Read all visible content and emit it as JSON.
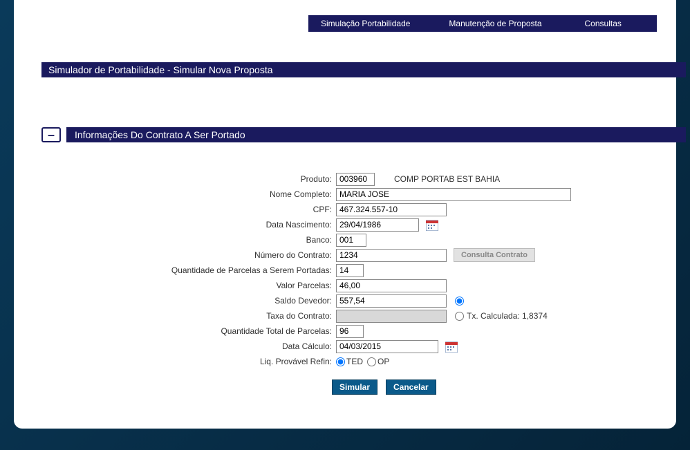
{
  "menu": {
    "simulacao": "Simulação Portabilidade",
    "manutencao": "Manutenção de Proposta",
    "consultas": "Consultas"
  },
  "page_title": "Simulador de Portabilidade - Simular Nova Proposta",
  "section": {
    "collapse_symbol": "–",
    "title": "Informações Do Contrato A Ser Portado"
  },
  "labels": {
    "produto": "Produto:",
    "nome": "Nome Completo:",
    "cpf": "CPF:",
    "data_nasc": "Data Nascimento:",
    "banco": "Banco:",
    "num_contrato": "Número do Contrato:",
    "qtd_parc_portadas": "Quantidade de Parcelas a Serem Portadas:",
    "valor_parcelas": "Valor Parcelas:",
    "saldo_devedor": "Saldo Devedor:",
    "taxa_contrato": "Taxa do Contrato:",
    "qtd_total_parcelas": "Quantidade Total de Parcelas:",
    "data_calculo": "Data Cálculo:",
    "liq_provavel": "Liq. Provável Refin:"
  },
  "values": {
    "produto": "003960",
    "produto_desc": "COMP PORTAB EST BAHIA",
    "nome": "MARIA JOSE",
    "cpf": "467.324.557-10",
    "data_nasc": "29/04/1986",
    "banco": "001",
    "num_contrato": "1234",
    "qtd_parc_portadas": "14",
    "valor_parcelas": "46,00",
    "saldo_devedor": "557,54",
    "taxa_contrato": "",
    "qtd_total_parcelas": "96",
    "data_calculo": "04/03/2015"
  },
  "options": {
    "tx_calculada": "Tx. Calculada: 1,8374",
    "ted": "TED",
    "op": "OP"
  },
  "buttons": {
    "consulta": "Consulta Contrato",
    "simular": "Simular",
    "cancelar": "Cancelar"
  }
}
